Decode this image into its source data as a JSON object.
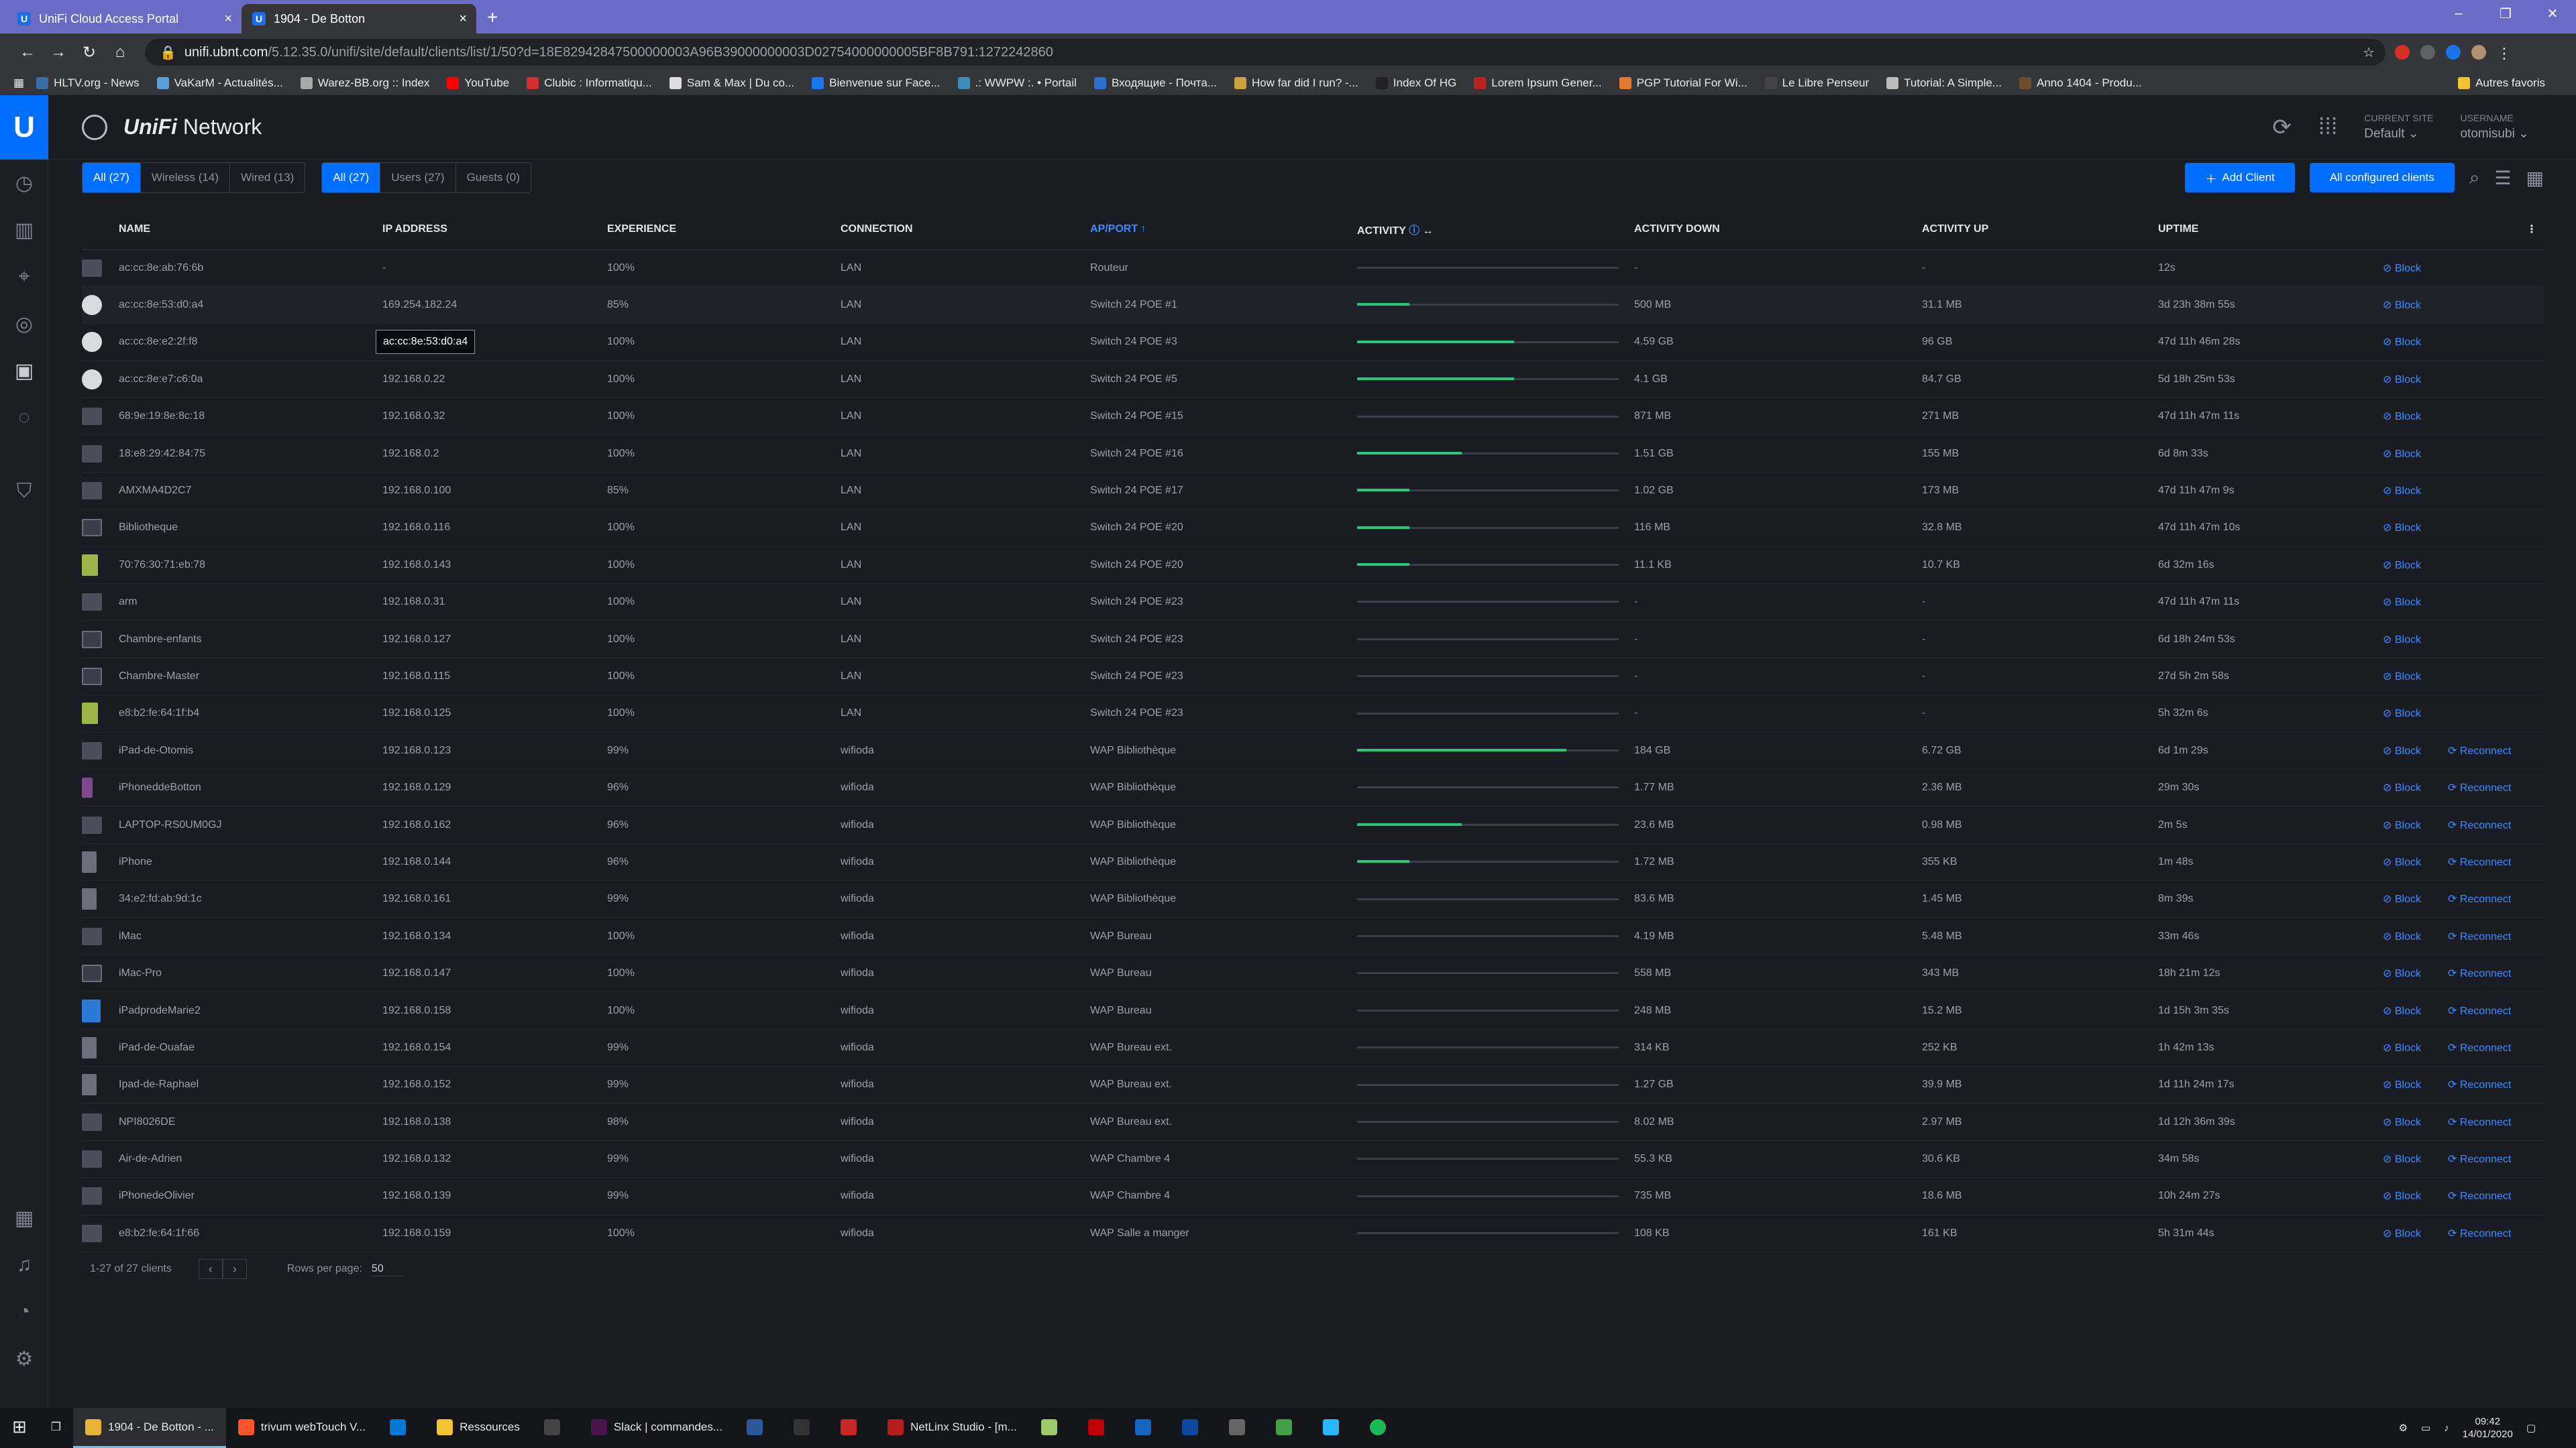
{
  "browser": {
    "tabs": [
      {
        "label": "UniFi Cloud Access Portal",
        "active": false
      },
      {
        "label": "1904 - De Botton",
        "active": true
      }
    ],
    "url_domain": "unifi.ubnt.com",
    "url_path": "/5.12.35.0/unifi/site/default/clients/list/1/50?d=18E82942847500000003A96B39000000003D02754000000005BF8B791:1272242860",
    "bookmarks": [
      "HLTV.org - News",
      "VaKarM - Actualités...",
      "Warez-BB.org :: Index",
      "YouTube",
      "Clubic : Informatiqu...",
      "Sam & Max | Du co...",
      "Bienvenue sur Face...",
      ".: WWPW :. • Portail",
      "Входящие - Почта...",
      "How far did I run? -...",
      "Index Of HG",
      "Lorem Ipsum Gener...",
      "PGP Tutorial For Wi...",
      "Le Libre Penseur",
      "Tutorial: A Simple...",
      "Anno 1404 - Produ..."
    ],
    "other_bookmarks": "Autres favoris"
  },
  "app": {
    "name_italic": "UniFi",
    "name_rest": " Network",
    "current_site_label": "CURRENT SITE",
    "current_site": "Default",
    "username_label": "USERNAME",
    "username": "otomisubi"
  },
  "filters": {
    "type": [
      "All (27)",
      "Wireless (14)",
      "Wired (13)"
    ],
    "group": [
      "All (27)",
      "Users (27)",
      "Guests (0)"
    ],
    "add_client": "Add Client",
    "configured": "All configured clients"
  },
  "table": {
    "columns": [
      "NAME",
      "IP ADDRESS",
      "EXPERIENCE",
      "CONNECTION",
      "AP/PORT",
      "ACTIVITY",
      "ACTIVITY DOWN",
      "ACTIVITY UP",
      "UPTIME"
    ],
    "block_label": "Block",
    "reconnect_label": "Reconnect",
    "rows": [
      {
        "icon": "generic",
        "name": "ac:cc:8e:ab:76:6b",
        "ip": "-",
        "exp": "100%",
        "conn": "LAN",
        "ap": "Routeur",
        "act": 0,
        "down": "-",
        "up": "-",
        "uptime": "12s",
        "reconnect": false
      },
      {
        "icon": "cam",
        "name": "ac:cc:8e:53:d0:a4",
        "ip": "169.254.182.24",
        "exp": "85%",
        "conn": "LAN",
        "ap": "Switch 24 POE #1",
        "act": 0.2,
        "down": "500 MB",
        "up": "31.1 MB",
        "uptime": "3d 23h 38m 55s",
        "reconnect": false
      },
      {
        "icon": "cam",
        "name": "ac:cc:8e:e2:2f:f8",
        "ip": "",
        "exp": "100%",
        "conn": "LAN",
        "ap": "Switch 24 POE #3",
        "act": 0.6,
        "down": "4.59 GB",
        "up": "96 GB",
        "uptime": "47d 11h 46m 28s",
        "reconnect": false
      },
      {
        "icon": "cam",
        "name": "ac:cc:8e:e7:c6:0a",
        "ip": "192.168.0.22",
        "exp": "100%",
        "conn": "LAN",
        "ap": "Switch 24 POE #5",
        "act": 0.6,
        "down": "4.1 GB",
        "up": "84.7 GB",
        "uptime": "5d 18h 25m 53s",
        "reconnect": false
      },
      {
        "icon": "generic",
        "name": "68:9e:19:8e:8c:18",
        "ip": "192.168.0.32",
        "exp": "100%",
        "conn": "LAN",
        "ap": "Switch 24 POE #15",
        "act": 0,
        "down": "871 MB",
        "up": "271 MB",
        "uptime": "47d 11h 47m 11s",
        "reconnect": false
      },
      {
        "icon": "generic",
        "name": "18:e8:29:42:84:75",
        "ip": "192.168.0.2",
        "exp": "100%",
        "conn": "LAN",
        "ap": "Switch 24 POE #16",
        "act": 0.4,
        "down": "1.51 GB",
        "up": "155 MB",
        "uptime": "6d 8m 33s",
        "reconnect": false
      },
      {
        "icon": "generic",
        "name": "AMXMA4D2C7",
        "ip": "192.168.0.100",
        "exp": "85%",
        "conn": "LAN",
        "ap": "Switch 24 POE #17",
        "act": 0.2,
        "down": "1.02 GB",
        "up": "173 MB",
        "uptime": "47d 11h 47m 9s",
        "reconnect": false
      },
      {
        "icon": "pc",
        "name": "Bibliotheque",
        "ip": "192.168.0.116",
        "exp": "100%",
        "conn": "LAN",
        "ap": "Switch 24 POE #20",
        "act": 0.2,
        "down": "116 MB",
        "up": "32.8 MB",
        "uptime": "47d 11h 47m 10s",
        "reconnect": false
      },
      {
        "icon": "pi",
        "name": "70:76:30:71:eb:78",
        "ip": "192.168.0.143",
        "exp": "100%",
        "conn": "LAN",
        "ap": "Switch 24 POE #20",
        "act": 0.2,
        "down": "11.1 KB",
        "up": "10.7 KB",
        "uptime": "6d 32m 16s",
        "reconnect": false
      },
      {
        "icon": "generic",
        "name": "arm",
        "ip": "192.168.0.31",
        "exp": "100%",
        "conn": "LAN",
        "ap": "Switch 24 POE #23",
        "act": 0,
        "down": "-",
        "up": "-",
        "uptime": "47d 11h 47m 11s",
        "reconnect": false
      },
      {
        "icon": "pc",
        "name": "Chambre-enfants",
        "ip": "192.168.0.127",
        "exp": "100%",
        "conn": "LAN",
        "ap": "Switch 24 POE #23",
        "act": 0,
        "down": "-",
        "up": "-",
        "uptime": "6d 18h 24m 53s",
        "reconnect": false
      },
      {
        "icon": "pc",
        "name": "Chambre-Master",
        "ip": "192.168.0.115",
        "exp": "100%",
        "conn": "LAN",
        "ap": "Switch 24 POE #23",
        "act": 0,
        "down": "-",
        "up": "-",
        "uptime": "27d 5h 2m 58s",
        "reconnect": false
      },
      {
        "icon": "pi",
        "name": "e8:b2:fe:64:1f:b4",
        "ip": "192.168.0.125",
        "exp": "100%",
        "conn": "LAN",
        "ap": "Switch 24 POE #23",
        "act": 0,
        "down": "-",
        "up": "-",
        "uptime": "5h 32m 6s",
        "reconnect": false
      },
      {
        "icon": "generic",
        "name": "iPad-de-Otomis",
        "ip": "192.168.0.123",
        "exp": "99%",
        "conn": "wifioda",
        "ap": "WAP Bibliothèque",
        "act": 0.8,
        "down": "184 GB",
        "up": "6.72 GB",
        "uptime": "6d 1m 29s",
        "reconnect": true
      },
      {
        "icon": "phone",
        "name": "iPhoneddeBotton",
        "ip": "192.168.0.129",
        "exp": "96%",
        "conn": "wifioda",
        "ap": "WAP Bibliothèque",
        "act": 0,
        "down": "1.77 MB",
        "up": "2.36 MB",
        "uptime": "29m 30s",
        "reconnect": true
      },
      {
        "icon": "generic",
        "name": "LAPTOP-RS0UM0GJ",
        "ip": "192.168.0.162",
        "exp": "96%",
        "conn": "wifioda",
        "ap": "WAP Bibliothèque",
        "act": 0.4,
        "down": "23.6 MB",
        "up": "0.98 MB",
        "uptime": "2m 5s",
        "reconnect": true
      },
      {
        "icon": "ipad",
        "name": "iPhone",
        "ip": "192.168.0.144",
        "exp": "96%",
        "conn": "wifioda",
        "ap": "WAP Bibliothèque",
        "act": 0.2,
        "down": "1.72 MB",
        "up": "355 KB",
        "uptime": "1m 48s",
        "reconnect": true
      },
      {
        "icon": "ipad",
        "name": "34:e2:fd:ab:9d:1c",
        "ip": "192.168.0.161",
        "exp": "99%",
        "conn": "wifioda",
        "ap": "WAP Bibliothèque",
        "act": 0,
        "down": "83.6 MB",
        "up": "1.45 MB",
        "uptime": "8m 39s",
        "reconnect": true
      },
      {
        "icon": "generic",
        "name": "iMac",
        "ip": "192.168.0.134",
        "exp": "100%",
        "conn": "wifioda",
        "ap": "WAP Bureau",
        "act": 0,
        "down": "4.19 MB",
        "up": "5.48 MB",
        "uptime": "33m 46s",
        "reconnect": true
      },
      {
        "icon": "pc",
        "name": "iMac-Pro",
        "ip": "192.168.0.147",
        "exp": "100%",
        "conn": "wifioda",
        "ap": "WAP Bureau",
        "act": 0,
        "down": "558 MB",
        "up": "343 MB",
        "uptime": "18h 21m 12s",
        "reconnect": true
      },
      {
        "icon": "img",
        "name": "iPadprodeMarie2",
        "ip": "192.168.0.158",
        "exp": "100%",
        "conn": "wifioda",
        "ap": "WAP Bureau",
        "act": 0,
        "down": "248 MB",
        "up": "15.2 MB",
        "uptime": "1d 15h 3m 35s",
        "reconnect": true
      },
      {
        "icon": "ipad",
        "name": "iPad-de-Ouafae",
        "ip": "192.168.0.154",
        "exp": "99%",
        "conn": "wifioda",
        "ap": "WAP Bureau ext.",
        "act": 0,
        "down": "314 KB",
        "up": "252 KB",
        "uptime": "1h 42m 13s",
        "reconnect": true
      },
      {
        "icon": "ipad",
        "name": "Ipad-de-Raphael",
        "ip": "192.168.0.152",
        "exp": "99%",
        "conn": "wifioda",
        "ap": "WAP Bureau ext.",
        "act": 0,
        "down": "1.27 GB",
        "up": "39.9 MB",
        "uptime": "1d 11h 24m 17s",
        "reconnect": true
      },
      {
        "icon": "generic",
        "name": "NPI8026DE",
        "ip": "192.168.0.138",
        "exp": "98%",
        "conn": "wifioda",
        "ap": "WAP Bureau ext.",
        "act": 0,
        "down": "8.02 MB",
        "up": "2.97 MB",
        "uptime": "1d 12h 36m 39s",
        "reconnect": true
      },
      {
        "icon": "generic",
        "name": "Air-de-Adrien",
        "ip": "192.168.0.132",
        "exp": "99%",
        "conn": "wifioda",
        "ap": "WAP Chambre 4",
        "act": 0,
        "down": "55.3 KB",
        "up": "30.6 KB",
        "uptime": "34m 58s",
        "reconnect": true
      },
      {
        "icon": "generic",
        "name": "iPhonedeOlivier",
        "ip": "192.168.0.139",
        "exp": "99%",
        "conn": "wifioda",
        "ap": "WAP Chambre 4",
        "act": 0,
        "down": "735 MB",
        "up": "18.6 MB",
        "uptime": "10h 24m 27s",
        "reconnect": true
      },
      {
        "icon": "generic",
        "name": "e8:b2:fe:64:1f:66",
        "ip": "192.168.0.159",
        "exp": "100%",
        "conn": "wifioda",
        "ap": "WAP Salle a manger",
        "act": 0,
        "down": "108 KB",
        "up": "161 KB",
        "uptime": "5h 31m 44s",
        "reconnect": true
      }
    ]
  },
  "tooltip": "ac:cc:8e:53:d0:a4",
  "pager": {
    "summary": "1-27 of 27 clients",
    "rows_label": "Rows per page:",
    "rows_value": "50"
  },
  "taskbar": {
    "items": [
      {
        "label": "1904 - De Botton - ...",
        "active": true
      },
      {
        "label": "trivum webTouch V...",
        "active": false
      },
      {
        "label": "",
        "active": false
      },
      {
        "label": "Ressources",
        "active": false
      },
      {
        "label": "",
        "active": false
      },
      {
        "label": "Slack | commandes...",
        "active": false
      },
      {
        "label": "",
        "active": false
      },
      {
        "label": "",
        "active": false
      },
      {
        "label": "",
        "active": false
      },
      {
        "label": "NetLinx Studio - [m...",
        "active": false
      }
    ],
    "time": "09:42",
    "date": "14/01/2020"
  },
  "colors": {
    "accent": "#006fff",
    "good": "#26c97a",
    "upload": "#a96fff"
  }
}
